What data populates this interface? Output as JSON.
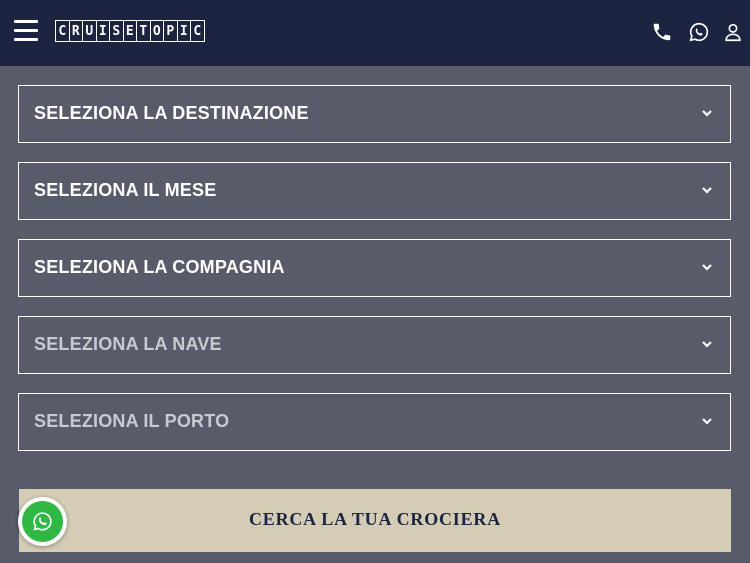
{
  "header": {
    "logo_letters": [
      "C",
      "R",
      "U",
      "I",
      "S",
      "E",
      "T",
      "O",
      "P",
      "I",
      "C"
    ],
    "icons": [
      "menu-icon",
      "phone-icon",
      "whatsapp-icon",
      "user-icon"
    ]
  },
  "form": {
    "selects": [
      {
        "label": "SELEZIONA LA DESTINAZIONE",
        "state": "enabled"
      },
      {
        "label": "SELEZIONA IL MESE",
        "state": "enabled"
      },
      {
        "label": "SELEZIONA LA COMPAGNIA",
        "state": "enabled"
      },
      {
        "label": "SELEZIONA LA NAVE",
        "state": "disabled"
      },
      {
        "label": "SELEZIONA IL PORTO",
        "state": "disabled"
      }
    ],
    "search_button": "CERCA LA TUA CROCIERA"
  },
  "colors": {
    "header_bg": "#1d2441",
    "page_bg": "#585b6a",
    "button_bg": "#d4ccb4",
    "button_text": "#1d2441",
    "whatsapp_green": "#2fb844"
  }
}
